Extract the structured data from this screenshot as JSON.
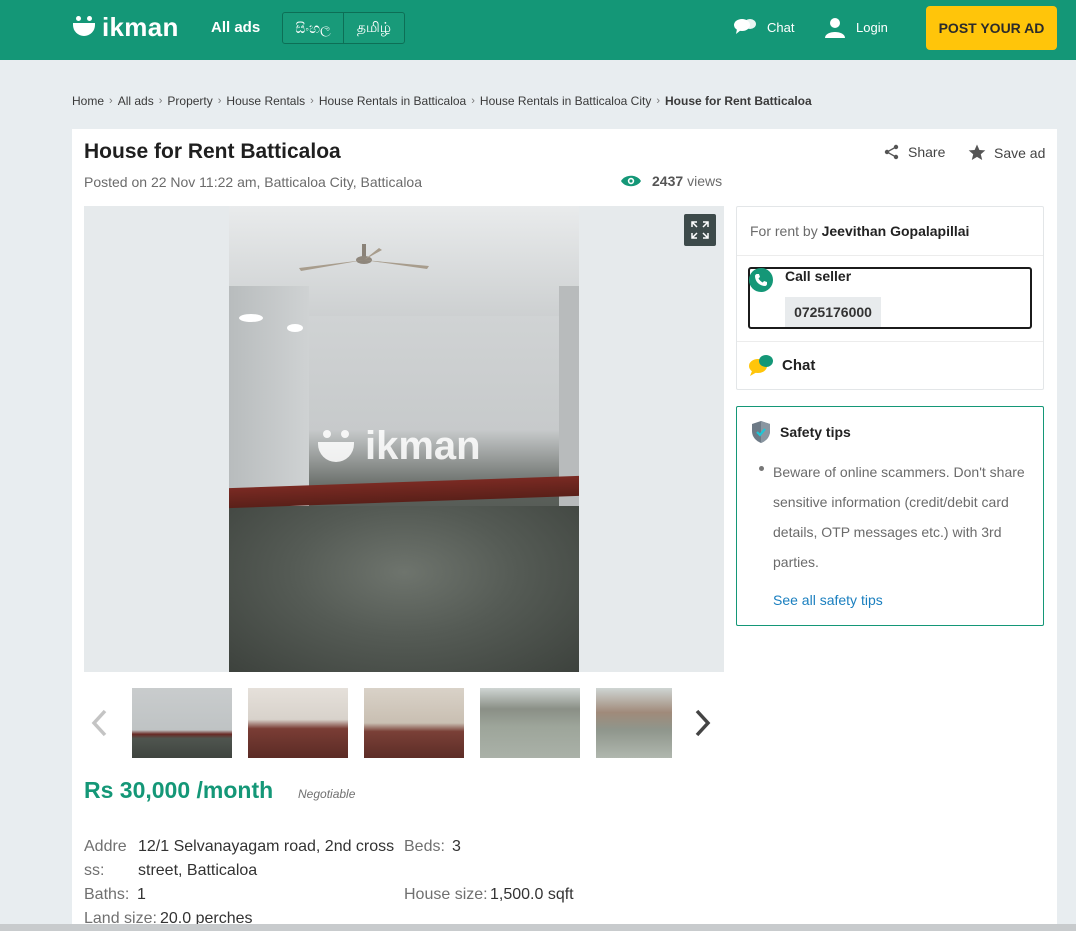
{
  "header": {
    "logo_text": "ikman",
    "all_ads": "All ads",
    "languages": [
      "සිංහල",
      "தமிழ்"
    ],
    "chat": "Chat",
    "login": "Login",
    "post_ad": "POST YOUR AD",
    "colors": {
      "brand": "#149777",
      "accent": "#ffc50a"
    }
  },
  "breadcrumb": [
    "Home",
    "All ads",
    "Property",
    "House Rentals",
    "House Rentals in Batticaloa",
    "House Rentals in Batticaloa City",
    "House for Rent Batticaloa"
  ],
  "ad": {
    "title": "House for Rent Batticaloa",
    "posted": "Posted on 22 Nov 11:22 am, Batticaloa City, Batticaloa",
    "views_count": "2437",
    "views_label": "views",
    "share": "Share",
    "save": "Save ad",
    "watermark": "ikman",
    "price": "Rs 30,000 /month",
    "negotiable": "Negotiable",
    "details": {
      "address_label_1": "Addre",
      "address_label_2": "ss:",
      "address_value_1": "12/1 Selvanayagam road, 2nd cross",
      "address_value_2": "street, Batticaloa",
      "beds_label": "Beds:",
      "beds_value": "3",
      "baths_label": "Baths:",
      "baths_value": "1",
      "house_size_label": "House size:",
      "house_size_value": "1,500.0 sqft",
      "land_size_label": "Land size:",
      "land_size_value": "20.0 perches"
    }
  },
  "seller": {
    "for_rent_by": "For rent by",
    "name": "Jeevithan Gopalapillai",
    "call_seller": "Call seller",
    "phone": "0725176000",
    "chat": "Chat"
  },
  "safety": {
    "title": "Safety tips",
    "text": "Beware of online scammers. Don't share sensitive information (credit/debit card details, OTP messages etc.) with 3rd parties.",
    "link": "See all safety tips"
  }
}
